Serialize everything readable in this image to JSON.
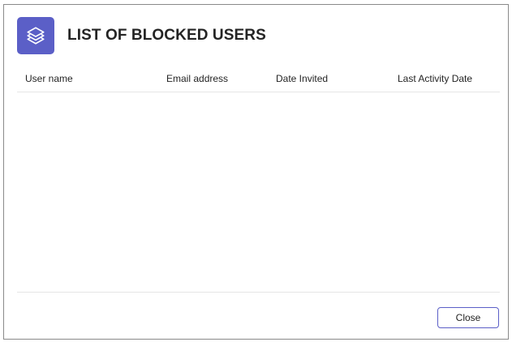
{
  "dialog": {
    "title": "LIST OF BLOCKED USERS",
    "icon": "layers-icon",
    "accent_color": "#5b5fc7"
  },
  "table": {
    "columns": [
      "User name",
      "Email address",
      "Date Invited",
      "Last Activity Date"
    ],
    "rows": []
  },
  "footer": {
    "close_label": "Close"
  }
}
